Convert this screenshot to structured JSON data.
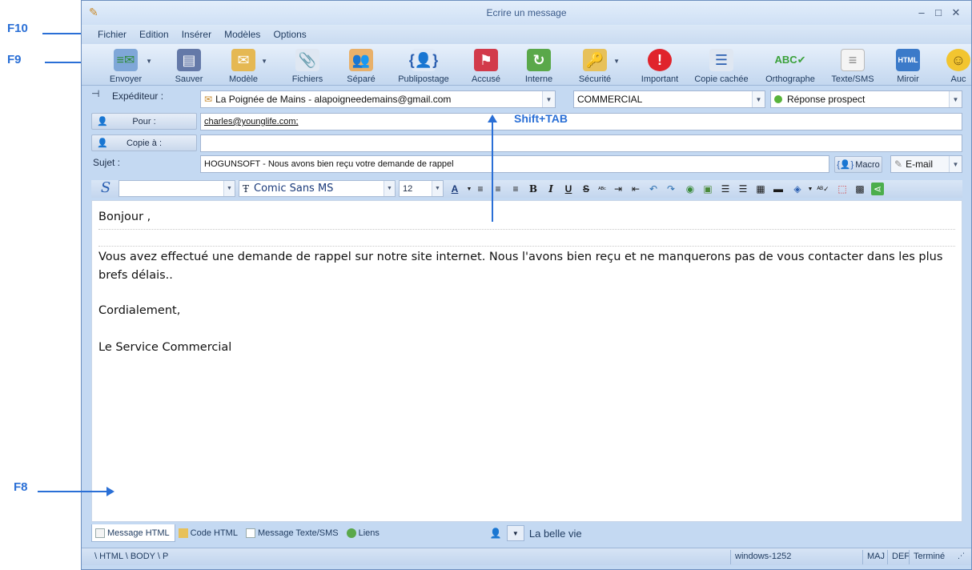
{
  "annotations": {
    "f10": "F10",
    "f9": "F9",
    "f8": "F8",
    "shift_tab": "Shift+TAB"
  },
  "window": {
    "title": "Ecrire un message"
  },
  "menu": [
    "Fichier",
    "Edition",
    "Insérer",
    "Modèles",
    "Options"
  ],
  "toolbar": {
    "envoyer": "Envoyer",
    "sauver": "Sauver",
    "modele": "Modèle",
    "fichiers": "Fichiers",
    "separe": "Séparé",
    "publipostage": "Publipostage",
    "accuse": "Accusé",
    "interne": "Interne",
    "securite": "Sécurité",
    "important": "Important",
    "copie_cachee": "Copie cachée",
    "orthographe": "Orthographe",
    "texte_sms": "Texte/SMS",
    "miroir": "Miroir",
    "auc": "Auc"
  },
  "headers": {
    "expediteur_label": "Expéditeur :",
    "expediteur_value": "La Poignée de Mains - alapoigneedemains@gmail.com",
    "category_value": "COMMERCIAL",
    "type_value": "Réponse prospect",
    "pour_label": "Pour :",
    "pour_value": "charles@younglife.com;",
    "copie_label": "Copie à :",
    "copie_value": "",
    "sujet_label": "Sujet :",
    "sujet_value": "HOGUNSOFT - Nous avons bien reçu votre demande de rappel",
    "macro_label": "Macro",
    "channel_value": "E-mail"
  },
  "format": {
    "style_value": "",
    "font_value": "Comic Sans MS",
    "size_value": "12"
  },
  "body": {
    "greeting": "Bonjour ,",
    "paragraph": "Vous avez effectué une demande de rappel sur notre site internet. Nous l'avons bien reçu et ne manquerons pas de vous contacter dans les plus brefs délais..",
    "closing": "Cordialement,",
    "signature": "Le Service Commercial"
  },
  "tabs": [
    "Message HTML",
    "Code HTML",
    "Message Texte/SMS",
    "Liens"
  ],
  "signature_selector": "La belle vie",
  "status": {
    "path": "\\ HTML \\ BODY \\ P",
    "encoding": "windows-1252",
    "maj": "MAJ",
    "def": "DEF",
    "state": "Terminé"
  },
  "colors": {
    "accent": "#2a6fd6",
    "window_bg": "#c4d9f2",
    "text": "#1e3a5f"
  }
}
